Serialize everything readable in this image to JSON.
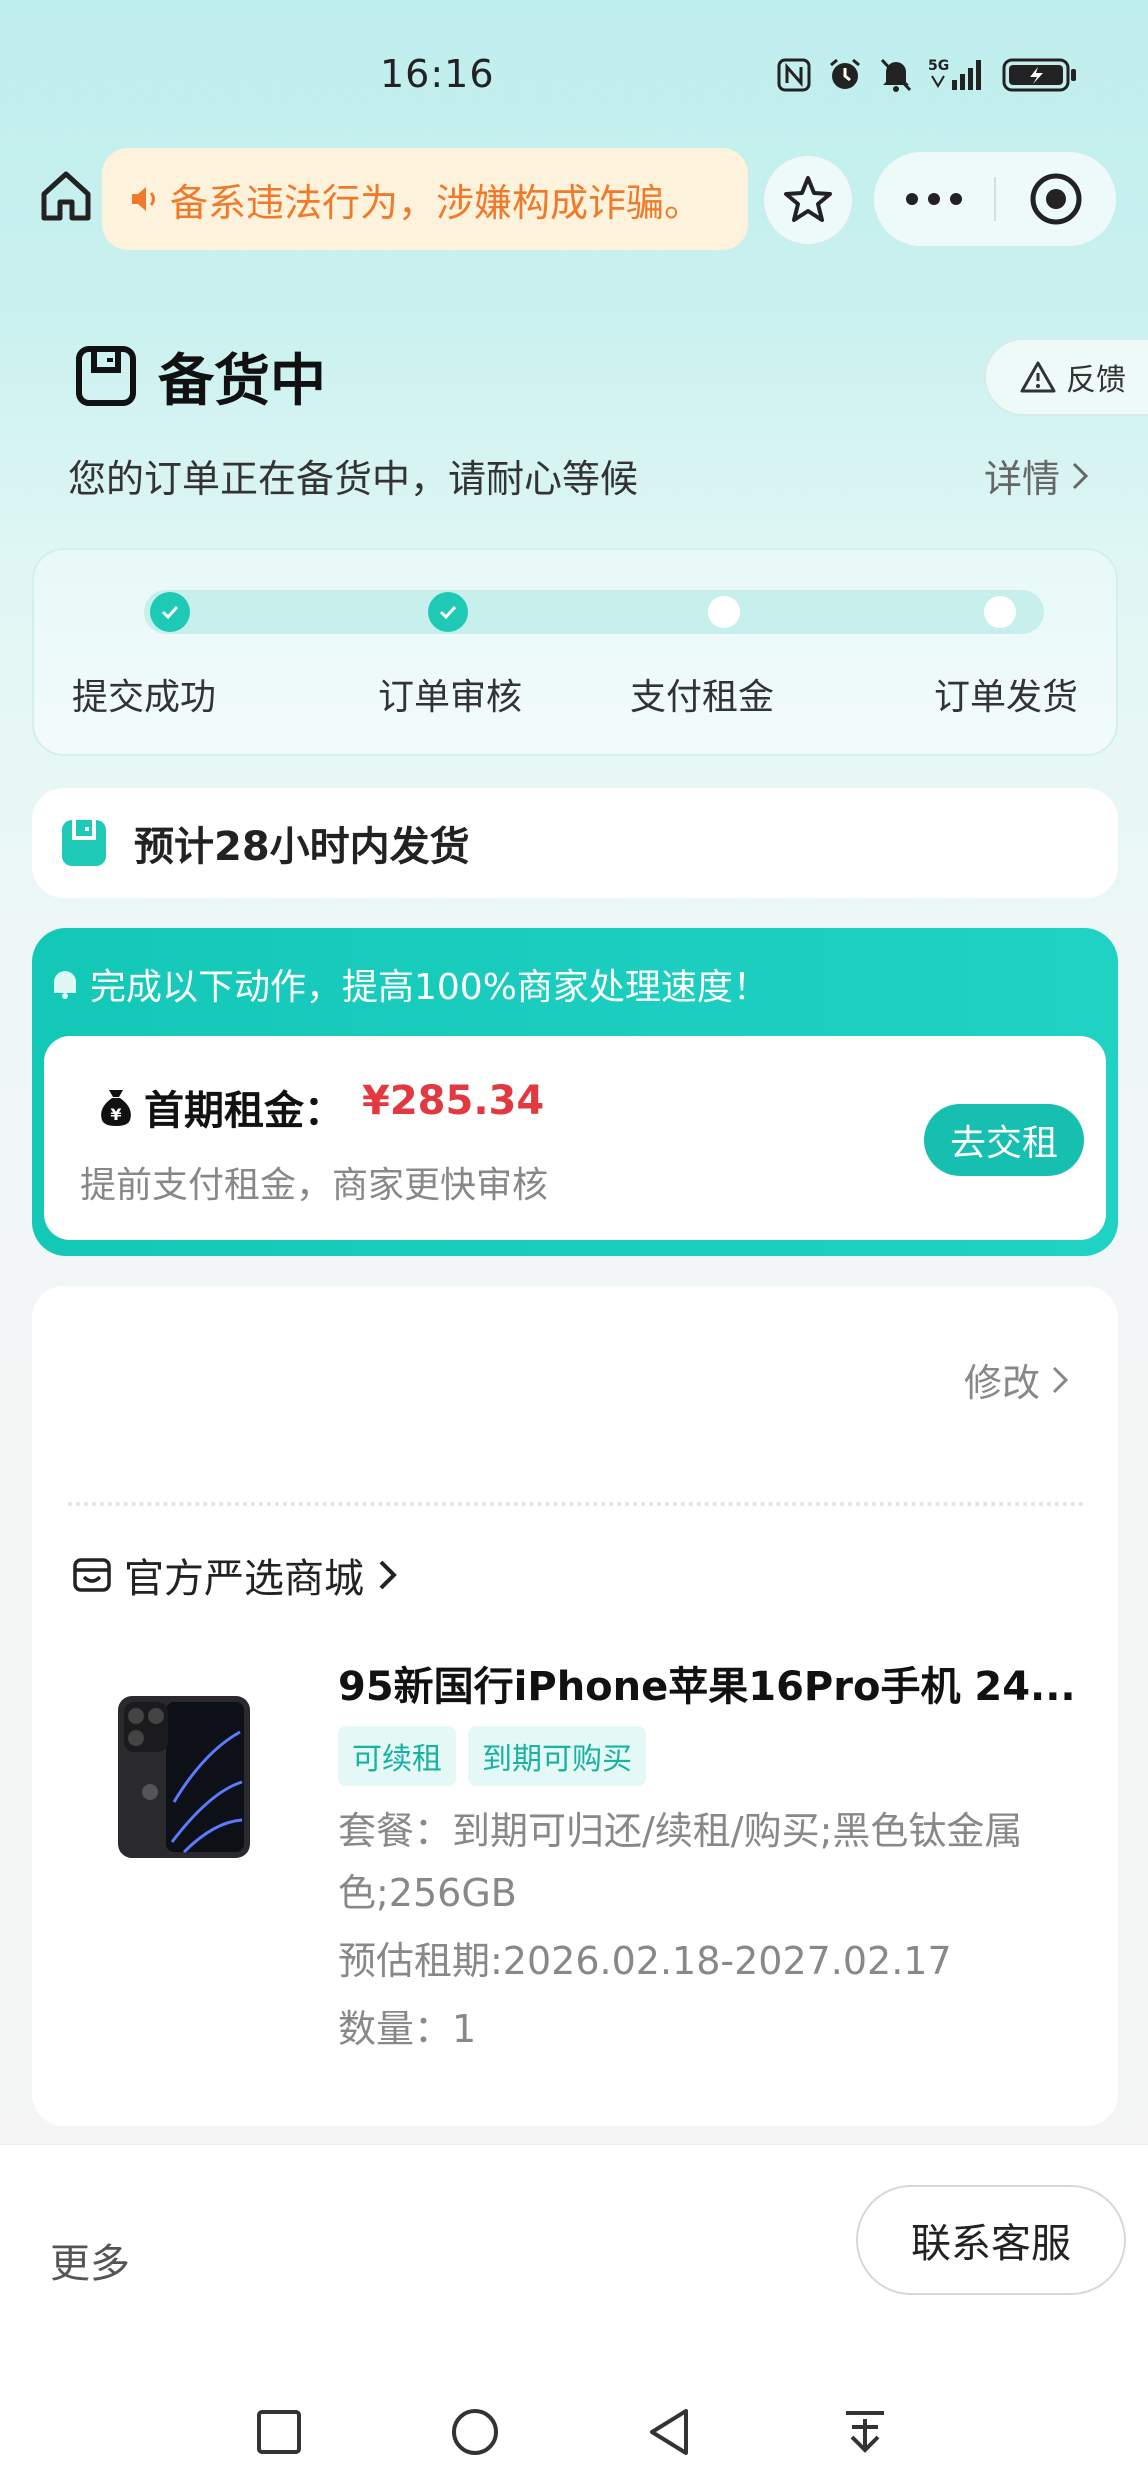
{
  "status_bar": {
    "time": "16:16",
    "signal_label": "5G"
  },
  "nav": {
    "notice_text": "备系违法行为，涉嫌构成诈骗。",
    "icons": [
      "home-icon",
      "speaker-icon",
      "star-icon",
      "more-icon",
      "target-icon"
    ]
  },
  "header": {
    "title": "备货中",
    "feedback_label": "反馈",
    "subtitle": "您的订单正在备货中，请耐心等候",
    "detail_label": "详情"
  },
  "progress": {
    "steps": [
      {
        "label": "提交成功",
        "done": true
      },
      {
        "label": "订单审核",
        "done": true
      },
      {
        "label": "支付租金",
        "done": false
      },
      {
        "label": "订单发货",
        "done": false
      }
    ]
  },
  "shipping": {
    "text": "预计28小时内发货"
  },
  "promo": {
    "headline": "完成以下动作，提高100%商家处理速度！",
    "rent_label": "首期租金：",
    "rent_price": "¥285.34",
    "rent_sub": "提前支付租金，商家更快审核",
    "pay_button": "去交租"
  },
  "product_card": {
    "modify_label": "修改",
    "shop_name": "官方严选商城",
    "title": "95新国行iPhone苹果16Pro手机 24...",
    "tags": [
      "可续租",
      "到期可购买"
    ],
    "plan_line1": "套餐：到期可归还/续租/购买;黑色钛金属",
    "plan_line2": "色;256GB",
    "period": "预估租期:2026.02.18-2027.02.17",
    "quantity": "数量：1"
  },
  "bottom": {
    "more_label": "更多",
    "service_button": "联系客服"
  },
  "colors": {
    "accent": "#1ec9b5",
    "price": "#e2383f",
    "notice": "#f07a2a"
  }
}
